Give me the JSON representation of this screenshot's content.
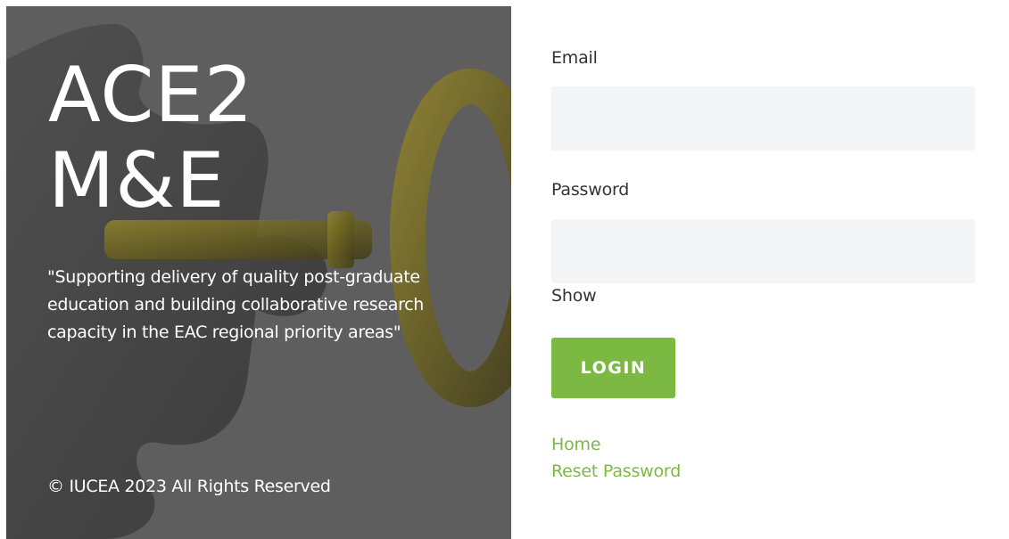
{
  "hero": {
    "title_line1": "ACE2",
    "title_line2": "M&E",
    "tagline": "\"Supporting delivery of quality post-graduate education and building collaborative research capacity in the EAC regional priority areas\"",
    "footer": "© IUCEA 2023  All Rights Reserved",
    "background_image": "puzzle-piece-with-key"
  },
  "form": {
    "email_label": "Email",
    "email_value": "",
    "password_label": "Password",
    "password_value": "",
    "show_label": "Show",
    "login_label": "LOGIN"
  },
  "links": {
    "home": "Home",
    "reset_password": "Reset Password"
  },
  "colors": {
    "accent": "#7cb943",
    "hero_bg": "#5c5c5c",
    "input_bg": "#f4f5f7"
  }
}
